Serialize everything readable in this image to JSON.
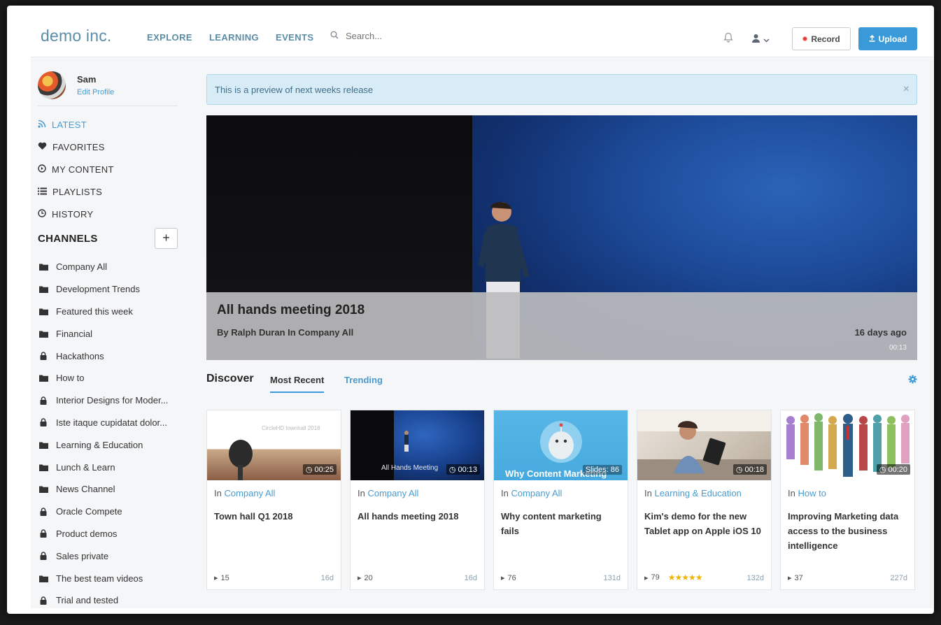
{
  "header": {
    "logo": "demo inc.",
    "nav": [
      "EXPLORE",
      "LEARNING",
      "EVENTS"
    ],
    "search_placeholder": "Search...",
    "record_label": "Record",
    "upload_label": "Upload"
  },
  "profile": {
    "name": "Sam",
    "edit_label": "Edit Profile"
  },
  "menu": [
    {
      "label": "LATEST",
      "icon": "rss-icon",
      "active": true
    },
    {
      "label": "FAVORITES",
      "icon": "heart-icon",
      "active": false
    },
    {
      "label": "MY CONTENT",
      "icon": "play-circle-icon",
      "active": false
    },
    {
      "label": "PLAYLISTS",
      "icon": "list-icon",
      "active": false
    },
    {
      "label": "HISTORY",
      "icon": "clock-icon",
      "active": false
    }
  ],
  "channels_title": "CHANNELS",
  "channels": [
    {
      "label": "Company All",
      "icon": "folder-icon"
    },
    {
      "label": "Development Trends",
      "icon": "folder-icon"
    },
    {
      "label": "Featured this week",
      "icon": "folder-icon"
    },
    {
      "label": "Financial",
      "icon": "folder-icon"
    },
    {
      "label": "Hackathons",
      "icon": "lock-icon"
    },
    {
      "label": "How to",
      "icon": "folder-icon"
    },
    {
      "label": "Interior Designs for Moder...",
      "icon": "lock-icon"
    },
    {
      "label": "Iste itaque cupidatat dolor...",
      "icon": "lock-icon"
    },
    {
      "label": "Learning & Education",
      "icon": "folder-icon"
    },
    {
      "label": "Lunch & Learn",
      "icon": "folder-icon"
    },
    {
      "label": "News Channel",
      "icon": "folder-icon"
    },
    {
      "label": "Oracle Compete",
      "icon": "lock-icon"
    },
    {
      "label": "Product demos",
      "icon": "lock-icon"
    },
    {
      "label": "Sales private",
      "icon": "lock-icon"
    },
    {
      "label": "The best team videos",
      "icon": "folder-icon"
    },
    {
      "label": "Trial and tested",
      "icon": "lock-icon"
    }
  ],
  "alert": {
    "text": "This is a preview of next weeks release",
    "close": "×"
  },
  "hero": {
    "title": "All hands meeting 2018",
    "meta": "By Ralph Duran In Company All",
    "ago": "16 days ago",
    "duration": "00:13"
  },
  "discover": {
    "title": "Discover",
    "tabs": [
      "Most Recent",
      "Trending"
    ]
  },
  "cards": [
    {
      "in": "In",
      "channel": "Company All",
      "title": "Town hall Q1 2018",
      "views": "15",
      "age": "16d",
      "duration": "00:25",
      "thumb_text": "CircleHD townhall 2018"
    },
    {
      "in": "In",
      "channel": "Company All",
      "title": "All hands meeting 2018",
      "views": "20",
      "age": "16d",
      "duration": "00:13",
      "thumb_text": "All Hands Meeting"
    },
    {
      "in": "In",
      "channel": "Company All",
      "title": "Why content marketing fails",
      "views": "76",
      "age": "131d",
      "slides": "Slides: 86",
      "thumb_text": "Why Content Marketing"
    },
    {
      "in": "In",
      "channel": "Learning & Education",
      "title": "Kim's demo for the new Tablet app on Apple iOS 10",
      "views": "79",
      "age": "132d",
      "duration": "00:18",
      "rating": 5
    },
    {
      "in": "In",
      "channel": "How to",
      "title": "Improving Marketing data access to the business intelligence",
      "views": "37",
      "age": "227d",
      "duration": "00:20"
    }
  ]
}
